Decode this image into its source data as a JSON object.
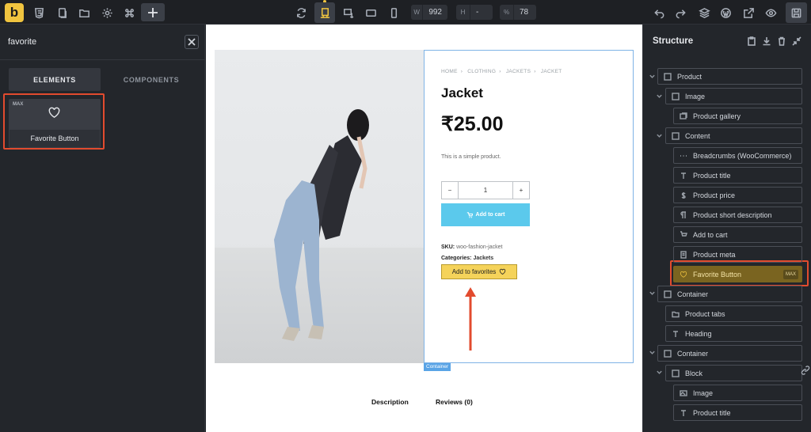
{
  "topbar": {
    "logo": "b",
    "width_label": "W",
    "width_value": "992",
    "height_label": "H",
    "height_value": "-",
    "zoom_label": "%",
    "zoom_value": "78"
  },
  "left_panel": {
    "search_value": "favorite",
    "tabs": [
      "ELEMENTS",
      "COMPONENTS"
    ],
    "element": {
      "badge": "MAX",
      "name": "Favorite Button",
      "icon": "heart-icon"
    }
  },
  "canvas": {
    "breadcrumbs": [
      "HOME",
      "CLOTHING",
      "JACKETS",
      "JACKET"
    ],
    "breadcrumb_sep": "›",
    "product_title": "Jacket",
    "price": "₹25.00",
    "short_description": "This is a simple product.",
    "quantity": {
      "minus": "−",
      "value": "1",
      "plus": "+"
    },
    "add_to_cart": "Add to cart",
    "sku_label": "SKU:",
    "sku_value": "woo-fashion-jacket",
    "categories_label": "Categories:",
    "categories_value": "Jackets",
    "favorite_button": "Add to favorites",
    "container_tag": "Container",
    "tabs": [
      "Description",
      "Reviews (0)"
    ]
  },
  "structure": {
    "title": "Structure",
    "nodes": [
      {
        "label": "Product",
        "icon": "square-icon"
      },
      {
        "label": "Image",
        "icon": "square-icon"
      },
      {
        "label": "Product gallery",
        "icon": "gallery-icon"
      },
      {
        "label": "Content",
        "icon": "square-icon"
      },
      {
        "label": "Breadcrumbs (WooCommerce)",
        "icon": "dots-icon"
      },
      {
        "label": "Product title",
        "icon": "text-icon"
      },
      {
        "label": "Product price",
        "icon": "dollar-icon"
      },
      {
        "label": "Product short description",
        "icon": "paragraph-icon"
      },
      {
        "label": "Add to cart",
        "icon": "cart-icon"
      },
      {
        "label": "Product meta",
        "icon": "document-icon"
      },
      {
        "label": "Favorite Button",
        "icon": "heart-icon",
        "badge": "MAX"
      },
      {
        "label": "Container",
        "icon": "square-icon"
      },
      {
        "label": "Product tabs",
        "icon": "folder-icon"
      },
      {
        "label": "Heading",
        "icon": "text-icon"
      },
      {
        "label": "Container",
        "icon": "square-icon"
      },
      {
        "label": "Block",
        "icon": "square-icon"
      },
      {
        "label": "Image",
        "icon": "image-icon"
      },
      {
        "label": "Product title",
        "icon": "text-icon"
      }
    ]
  },
  "colors": {
    "accent": "#f0c43f",
    "highlight": "#e24b2e",
    "cart_button": "#5bc9ec",
    "favorite_button": "#f5d35a"
  }
}
